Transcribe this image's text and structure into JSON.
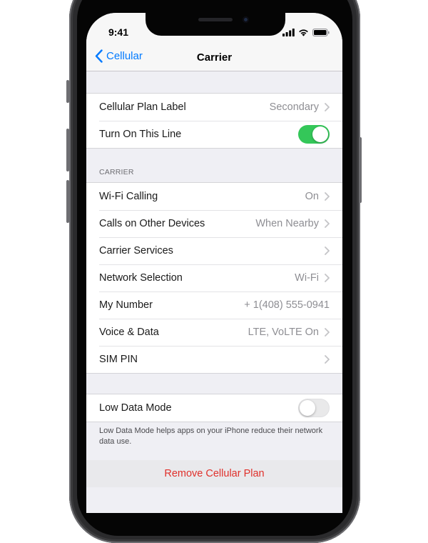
{
  "status_bar": {
    "time": "9:41"
  },
  "nav": {
    "back_label": "Cellular",
    "title": "Carrier"
  },
  "plan_group": [
    {
      "label": "Cellular Plan Label",
      "value": "Secondary",
      "chevron": true
    },
    {
      "label": "Turn On This Line",
      "toggle": "on"
    }
  ],
  "carrier_section": {
    "header": "CARRIER",
    "rows": [
      {
        "label": "Wi-Fi Calling",
        "value": "On",
        "chevron": true
      },
      {
        "label": "Calls on Other Devices",
        "value": "When Nearby",
        "chevron": true
      },
      {
        "label": "Carrier Services",
        "value": "",
        "chevron": true
      },
      {
        "label": "Network Selection",
        "value": "Wi-Fi",
        "chevron": true
      },
      {
        "label": "My Number",
        "value": "+ 1(408) 555-0941",
        "chevron": false
      },
      {
        "label": "Voice & Data",
        "value": "LTE, VoLTE On",
        "chevron": true
      },
      {
        "label": "SIM PIN",
        "value": "",
        "chevron": true
      }
    ]
  },
  "low_data": {
    "label": "Low Data Mode",
    "toggle": "off",
    "footer": "Low Data Mode helps apps on your iPhone reduce their network data use."
  },
  "remove_plan_label": "Remove Cellular Plan",
  "colors": {
    "accent": "#007aff",
    "toggle_on": "#34c759",
    "destructive": "#e0302b",
    "background": "#efeff4"
  },
  "icons": [
    "cellular-signal-icon",
    "wifi-icon",
    "battery-icon",
    "back-chevron-icon",
    "chevron-right-icon"
  ]
}
